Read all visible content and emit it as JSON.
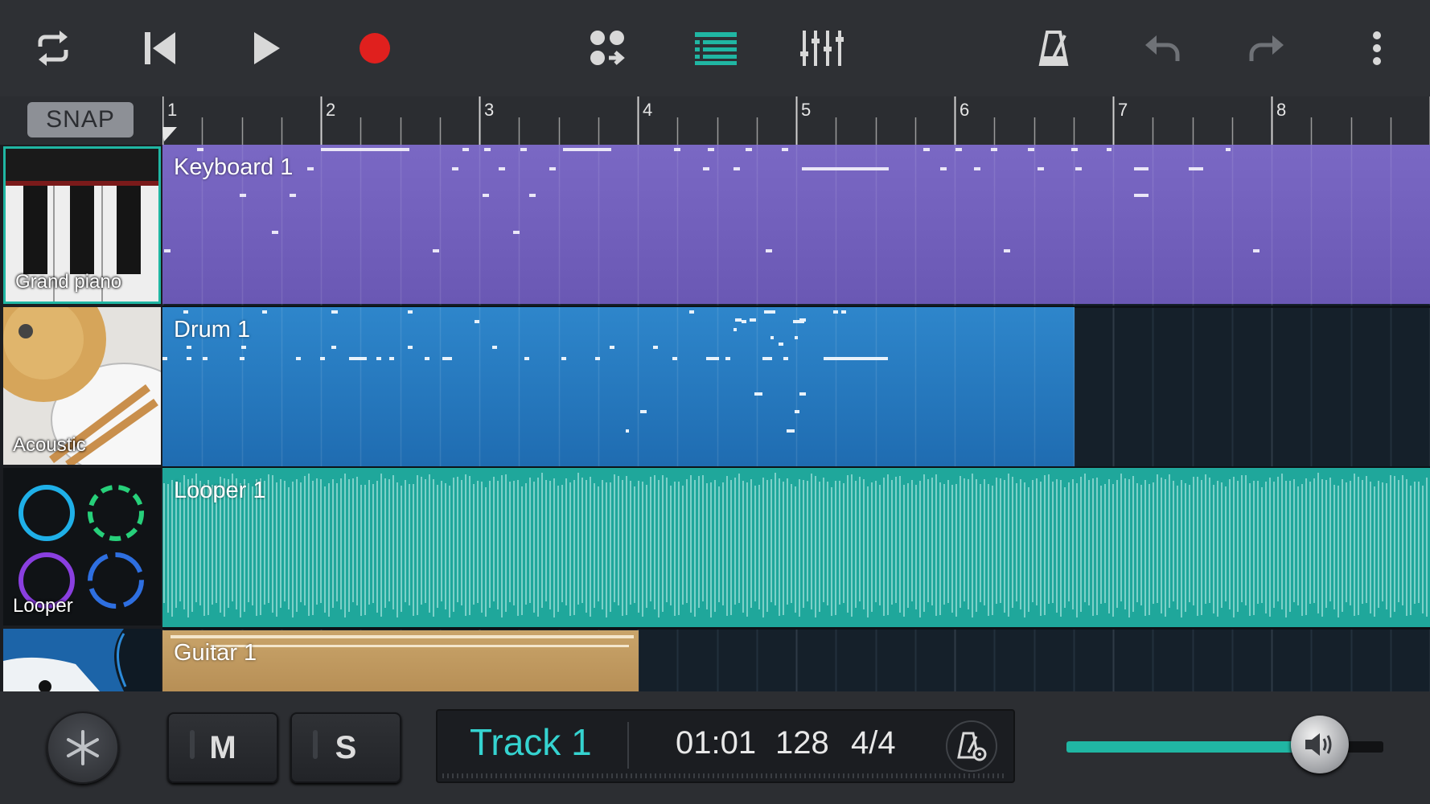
{
  "toolbar": {
    "buttons": [
      "loop-icon",
      "skip-back-icon",
      "play-icon",
      "record-icon",
      "pads-icon",
      "track-list-icon",
      "mixer-icon",
      "metronome-icon",
      "undo-icon",
      "redo-icon",
      "more-icon"
    ],
    "accent": "#20b6a3",
    "record_color": "#e0201e"
  },
  "ruler": {
    "snap_label": "SNAP",
    "bars": [
      "1",
      "2",
      "3",
      "4",
      "5",
      "6",
      "7",
      "8"
    ]
  },
  "tracks": [
    {
      "header_label": "Grand piano",
      "region_label": "Keyboard 1",
      "color": "#7764c2"
    },
    {
      "header_label": "Acoustic",
      "region_label": "Drum 1",
      "color": "#2b7fc4"
    },
    {
      "header_label": "Looper",
      "region_label": "Looper 1",
      "color": "#1fa79b"
    },
    {
      "header_label": "",
      "region_label": "Guitar 1",
      "color": "#c09a62"
    }
  ],
  "bottom": {
    "mute_label": "M",
    "solo_label": "S",
    "track_name": "Track 1",
    "position": "01:01",
    "tempo": "128",
    "time_signature": "4/4",
    "volume": 0.8
  }
}
